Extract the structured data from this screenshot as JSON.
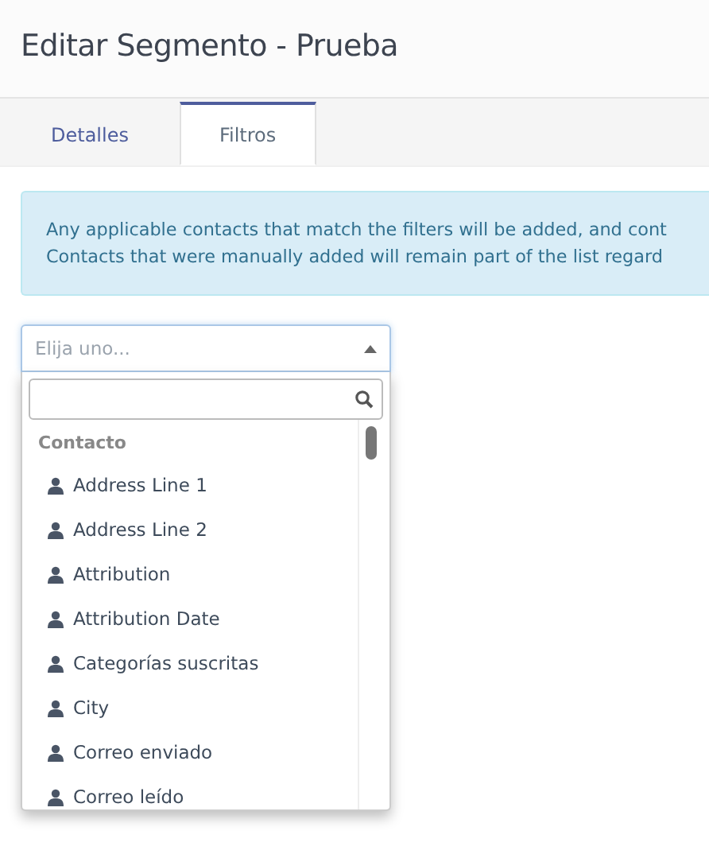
{
  "page": {
    "title": "Editar Segmento - Prueba"
  },
  "tabs": [
    {
      "label": "Detalles",
      "selected": false
    },
    {
      "label": "Filtros",
      "selected": true
    }
  ],
  "alert": {
    "lines": [
      "Any applicable contacts that match the filters will be added, and cont",
      "Contacts that were manually added will remain part of the list regard"
    ]
  },
  "select": {
    "placeholder": "Elija uno...",
    "expanded": true,
    "group": "Contacto",
    "options": [
      {
        "label": "Address Line 1"
      },
      {
        "label": "Address Line 2"
      },
      {
        "label": "Attribution"
      },
      {
        "label": "Attribution Date"
      },
      {
        "label": "Categorías suscritas"
      },
      {
        "label": "City"
      },
      {
        "label": "Correo enviado"
      },
      {
        "label": "Correo leído"
      }
    ]
  }
}
